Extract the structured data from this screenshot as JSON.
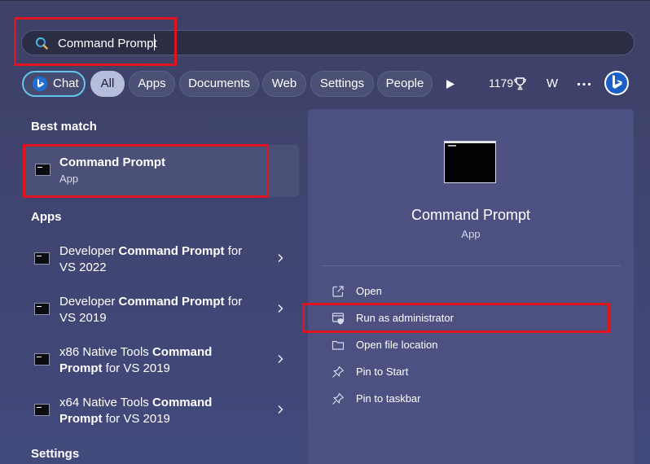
{
  "search": {
    "query": "Command Prompt"
  },
  "filters": {
    "chat": "Chat",
    "all": "All",
    "apps": "Apps",
    "documents": "Documents",
    "web": "Web",
    "settings": "Settings",
    "people": "People"
  },
  "toolbar": {
    "points": "1179",
    "avatar": "W"
  },
  "sections": {
    "best_match": "Best match",
    "apps": "Apps",
    "settings": "Settings"
  },
  "best_match": {
    "title": "Command Prompt",
    "subtitle": "App"
  },
  "apps": [
    {
      "line1_pre": "Developer ",
      "line1_bold": "Command Prompt",
      "line1_post": " for",
      "line2_bold": "",
      "line2_post": "VS 2022"
    },
    {
      "line1_pre": "Developer ",
      "line1_bold": "Command Prompt",
      "line1_post": " for",
      "line2_bold": "",
      "line2_post": "VS 2019"
    },
    {
      "line1_pre": "x86 Native Tools ",
      "line1_bold": "Command",
      "line1_post": "",
      "line2_bold": "Prompt",
      "line2_post": " for VS 2019"
    },
    {
      "line1_pre": "x64 Native Tools ",
      "line1_bold": "Command",
      "line1_post": "",
      "line2_bold": "Prompt",
      "line2_post": " for VS 2019"
    }
  ],
  "detail": {
    "title": "Command Prompt",
    "subtitle": "App",
    "actions": [
      "Open",
      "Run as administrator",
      "Open file location",
      "Pin to Start",
      "Pin to taskbar"
    ]
  },
  "colors": {
    "highlight": "#e0141f",
    "chat_ring": "#63c6ea",
    "panel": "#4c5181",
    "background": "#3f4470"
  }
}
